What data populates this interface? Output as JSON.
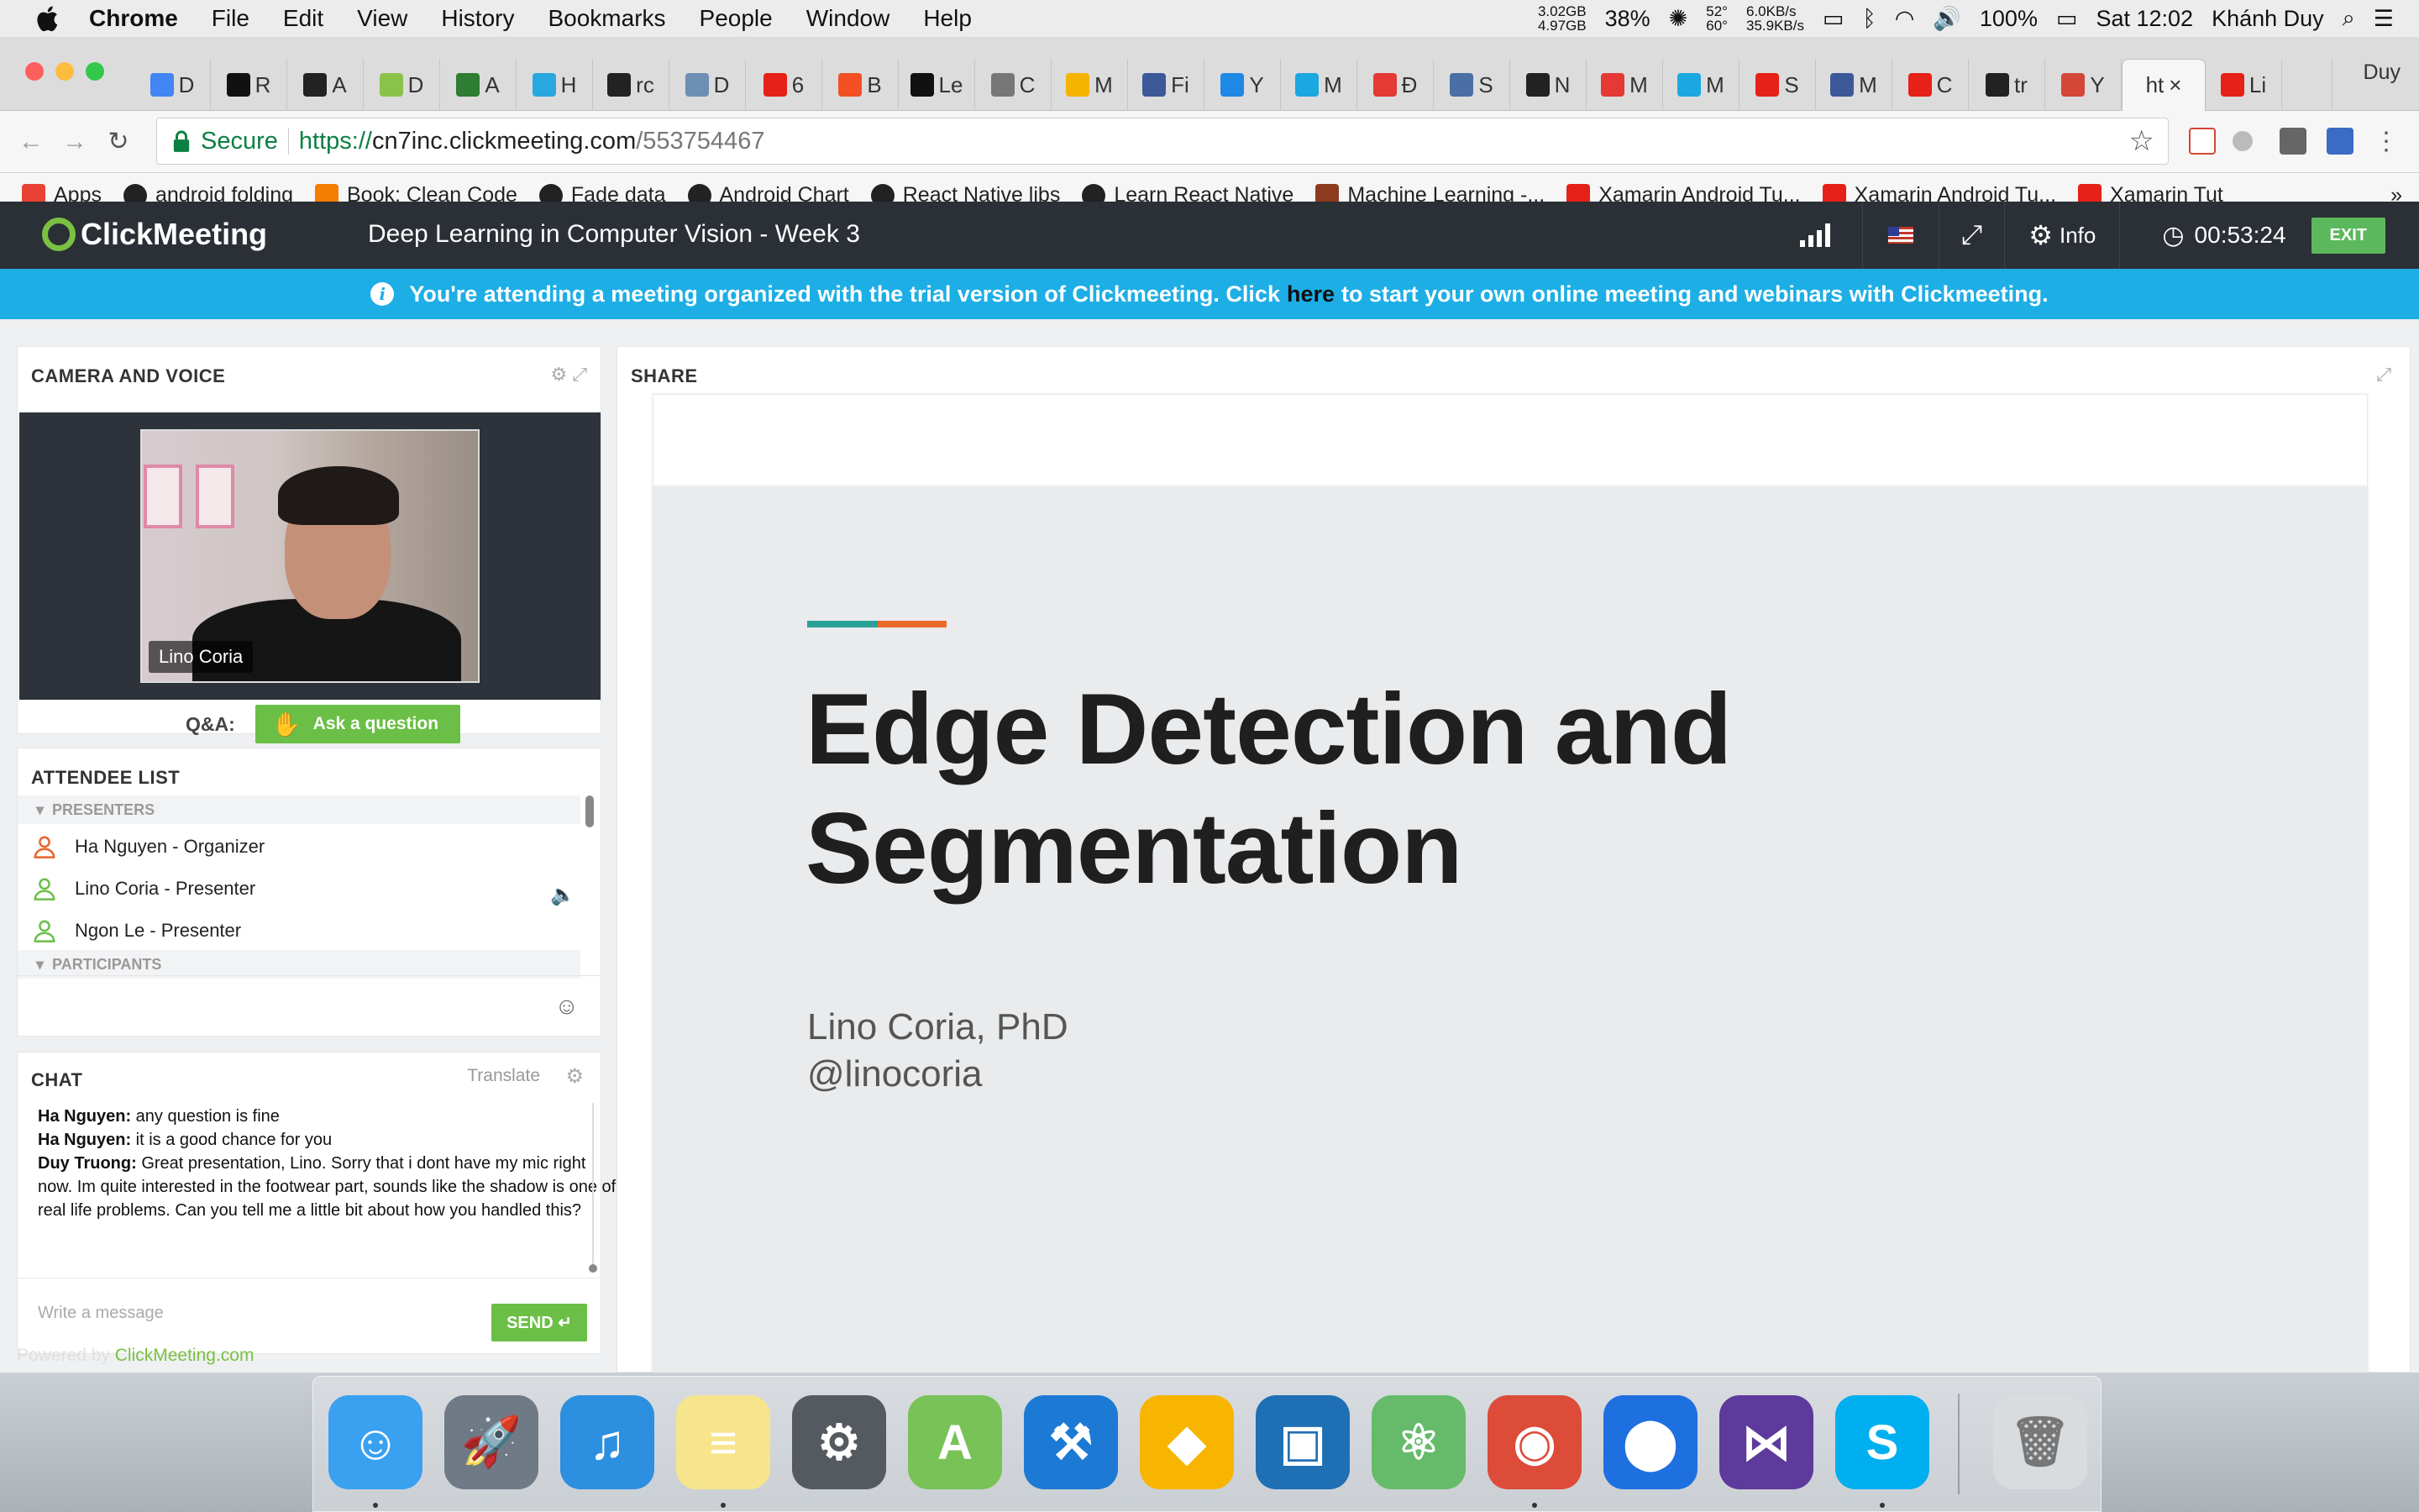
{
  "menubar": {
    "app": "Chrome",
    "items": [
      "File",
      "Edit",
      "View",
      "History",
      "Bookmarks",
      "People",
      "Window",
      "Help"
    ],
    "mem": [
      "3.02GB",
      "4.97GB"
    ],
    "cpu": "38%",
    "temp": [
      "52°",
      "60°"
    ],
    "net": [
      "6.0KB/s",
      "35.9KB/s"
    ],
    "battery": "100%",
    "clock": "Sat 12:02",
    "user": "Khánh Duy"
  },
  "tabs": [
    {
      "label": "D",
      "color": "#4285f4"
    },
    {
      "label": "R",
      "color": "#111111"
    },
    {
      "label": "A",
      "color": "#222222"
    },
    {
      "label": "D",
      "color": "#8bc34a"
    },
    {
      "label": "A",
      "color": "#2e7d32"
    },
    {
      "label": "H",
      "color": "#29a8e0"
    },
    {
      "label": "rc",
      "color": "#222222"
    },
    {
      "label": "D",
      "color": "#6d8fb3"
    },
    {
      "label": "6",
      "color": "#e62117"
    },
    {
      "label": "B",
      "color": "#f25022"
    },
    {
      "label": "Le",
      "color": "#111111"
    },
    {
      "label": "C",
      "color": "#777777"
    },
    {
      "label": "M",
      "color": "#f4b400"
    },
    {
      "label": "Fi",
      "color": "#3b5998"
    },
    {
      "label": "Y",
      "color": "#1e88e5"
    },
    {
      "label": "M",
      "color": "#1ba8e0"
    },
    {
      "label": "Đ",
      "color": "#e53935"
    },
    {
      "label": "S",
      "color": "#4a6fa5"
    },
    {
      "label": "N",
      "color": "#222222"
    },
    {
      "label": "M",
      "color": "#e53935"
    },
    {
      "label": "M",
      "color": "#1ba8e0"
    },
    {
      "label": "S",
      "color": "#e62117"
    },
    {
      "label": "M",
      "color": "#3b5998"
    },
    {
      "label": "C",
      "color": "#e62117"
    },
    {
      "label": "tr",
      "color": "#222222"
    },
    {
      "label": "Y",
      "color": "#d44638"
    }
  ],
  "active_tab": {
    "label": "ht",
    "close": "×"
  },
  "last_tab": {
    "label": "Li",
    "color": "#e62117"
  },
  "profile": "Duy",
  "address": {
    "secure": "Secure",
    "scheme": "https://",
    "host": "cn7inc.clickmeeting.com",
    "path": "/553754467"
  },
  "bookmarks": [
    {
      "label": "Apps",
      "color": "#e94235",
      "icon": "apps-grid-icon"
    },
    {
      "label": "android folding",
      "color": "#222222",
      "icon": "github-icon"
    },
    {
      "label": "Book: Clean Code",
      "color": "#f57d00",
      "icon": "blogger-icon"
    },
    {
      "label": "Fade data",
      "color": "#222222",
      "icon": "github-icon"
    },
    {
      "label": "Android Chart",
      "color": "#222222",
      "icon": "github-icon"
    },
    {
      "label": "React Native libs",
      "color": "#222222",
      "icon": "github-icon"
    },
    {
      "label": "Learn React Native",
      "color": "#222222",
      "icon": "github-icon"
    },
    {
      "label": "Machine Learning -...",
      "color": "#8d3b1e",
      "icon": "ml-icon"
    },
    {
      "label": "Xamarin Android Tu...",
      "color": "#e62117",
      "icon": "youtube-icon"
    },
    {
      "label": "Xamarin Android Tu...",
      "color": "#e62117",
      "icon": "youtube-icon"
    },
    {
      "label": "Xamarin Tut",
      "color": "#e62117",
      "icon": "youtube-icon"
    }
  ],
  "cm": {
    "logo": "ClickMeeting",
    "title": "Deep Learning in Computer Vision - Week 3",
    "info": "Info",
    "timer": "00:53:24",
    "exit": "EXIT",
    "banner_pre": "You're attending a meeting organized with the trial version of Clickmeeting. Click",
    "banner_link": "here",
    "banner_post": "to start your own online meeting and webinars with Clickmeeting.",
    "accent_color": "#7ac143"
  },
  "camera": {
    "title": "CAMERA AND VOICE",
    "name": "Lino Coria",
    "qa_label": "Q&A:",
    "ask": "Ask a question"
  },
  "attendees": {
    "title": "ATTENDEE LIST",
    "presenters_label": "PRESENTERS",
    "participants_label": "PARTICIPANTS",
    "list": [
      {
        "name": "Ha Nguyen - Organizer",
        "color": "#e8632b"
      },
      {
        "name": "Lino Coria - Presenter",
        "color": "#6bbf46"
      },
      {
        "name": "Ngon Le - Presenter",
        "color": "#6bbf46"
      }
    ]
  },
  "chat": {
    "title": "CHAT",
    "translate": "Translate",
    "messages": [
      {
        "who": "Ha Nguyen:",
        "text": " any question is fine"
      },
      {
        "who": "Ha Nguyen:",
        "text": " it is a good chance for you"
      },
      {
        "who": "Duy Truong:",
        "text": " Great presentation, Lino. Sorry that i dont have my mic right now. Im quite interested in the footwear part, sounds like the shadow is one of real life problems. Can you tell me a little bit about how you handled this?"
      }
    ],
    "placeholder": "Write a message",
    "send": "SEND"
  },
  "share": {
    "title": "SHARE",
    "slide_title_1": "Edge Detection and",
    "slide_title_2": "Segmentation",
    "author": "Lino Coria, PhD",
    "handle": "@linocoria"
  },
  "powered": {
    "pre": "Powered by ",
    "link": "ClickMeeting.com"
  },
  "dock": [
    {
      "name": "finder-icon",
      "bg": "#3aa0f0",
      "glyph": "☺",
      "dot": true
    },
    {
      "name": "launchpad-icon",
      "bg": "#6f7a86",
      "glyph": "🚀",
      "dot": false
    },
    {
      "name": "itunes-icon",
      "bg": "#2c8fe0",
      "glyph": "♫",
      "dot": false
    },
    {
      "name": "notes-icon",
      "bg": "#f6e58d",
      "glyph": "≡",
      "dot": true
    },
    {
      "name": "system-preferences-icon",
      "bg": "#555a60",
      "glyph": "⚙",
      "dot": false
    },
    {
      "name": "android-studio-icon",
      "bg": "#78c257",
      "glyph": "A",
      "dot": false
    },
    {
      "name": "xcode-icon",
      "bg": "#1c7ad4",
      "glyph": "⚒",
      "dot": false
    },
    {
      "name": "sketch-icon",
      "bg": "#f7b500",
      "glyph": "◆",
      "dot": false
    },
    {
      "name": "vmware-icon",
      "bg": "#1f6fb5",
      "glyph": "▣",
      "dot": false
    },
    {
      "name": "atom-icon",
      "bg": "#66bb6a",
      "glyph": "⚛",
      "dot": false
    },
    {
      "name": "chrome-icon",
      "bg": "#dd4b39",
      "glyph": "◉",
      "dot": true
    },
    {
      "name": "pin-app-icon",
      "bg": "#1e6fe0",
      "glyph": "⬤",
      "dot": false
    },
    {
      "name": "visual-studio-icon",
      "bg": "#5d3a9b",
      "glyph": "⋈",
      "dot": false
    },
    {
      "name": "skype-icon",
      "bg": "#00aff0",
      "glyph": "S",
      "dot": true
    },
    {
      "name": "trash-icon",
      "bg": "#d8dcdf",
      "glyph": "🗑",
      "dot": false
    }
  ]
}
